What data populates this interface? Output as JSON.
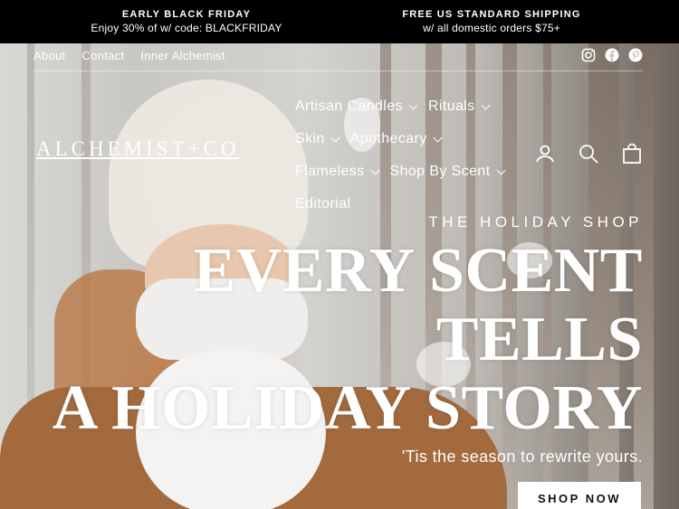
{
  "announcement": {
    "left_title": "EARLY BLACK FRIDAY",
    "left_detail": "Enjoy 30% of w/ code: BLACKFRIDAY",
    "right_title": "FREE US STANDARD SHIPPING",
    "right_detail": "w/ all domestic orders $75+"
  },
  "utility_links": [
    "About",
    "Contact",
    "Inner Alchemist"
  ],
  "social_icons": [
    "instagram-icon",
    "facebook-icon",
    "pinterest-icon"
  ],
  "logo": "ALCHEMIST+CO",
  "nav": {
    "items": [
      {
        "label": "Artisan Candles",
        "has_dropdown": true
      },
      {
        "label": "Rituals",
        "has_dropdown": true
      },
      {
        "label": "Skin",
        "has_dropdown": true
      },
      {
        "label": "Apothecary",
        "has_dropdown": true
      },
      {
        "label": "Flameless",
        "has_dropdown": true
      },
      {
        "label": "Shop By Scent",
        "has_dropdown": true
      },
      {
        "label": "Editorial",
        "has_dropdown": false
      }
    ]
  },
  "header_icons": [
    "account-icon",
    "search-icon",
    "cart-icon"
  ],
  "hero": {
    "eyebrow": "THE HOLIDAY SHOP",
    "headline_line1": "EVERY SCENT",
    "headline_line2": "TELLS",
    "headline_line3": "A HOLIDAY STORY",
    "subtext": "'Tis the season to rewrite yours.",
    "cta_label": "SHOP NOW"
  },
  "colors": {
    "announcement_bg": "#000000",
    "text_on_image": "#ffffff",
    "cta_bg": "#ffffff",
    "cta_text": "#111111"
  }
}
